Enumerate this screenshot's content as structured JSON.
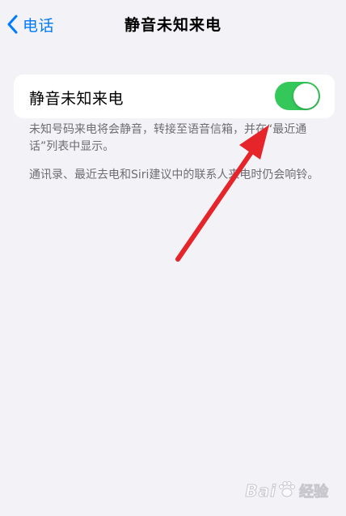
{
  "nav": {
    "back_label": "电话",
    "back_icon": "chevron-left-icon",
    "title": "静音未知来电"
  },
  "setting": {
    "label": "静音未知来电",
    "toggle_on": true,
    "toggle_color": "#34c759"
  },
  "footer": {
    "note1": "未知号码来电将会静音，转接至语音信箱，并在“最近通话”列表中显示。",
    "note2": "通讯录、最近去电和Siri建议中的联系人来电时仍会响铃。"
  },
  "annotation": {
    "arrow_color": "#e5252a"
  },
  "watermark": {
    "brand": "Bai",
    "brand2": "经验"
  },
  "colors": {
    "accent": "#007aff",
    "background": "#f2f2f7",
    "secondary_text": "#6d6d72"
  }
}
